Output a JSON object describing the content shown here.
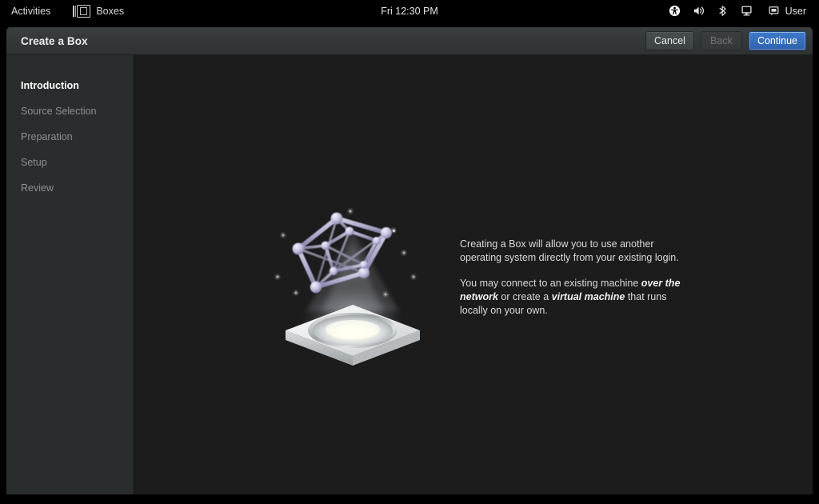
{
  "topbar": {
    "activities_label": "Activities",
    "app_name": "Boxes",
    "clock": "Fri 12:30 PM",
    "user_label": "User",
    "tray_icons": [
      "accessibility-icon",
      "volume-icon",
      "bluetooth-icon",
      "display-icon",
      "message-icon"
    ]
  },
  "window": {
    "title": "Create a Box",
    "buttons": {
      "cancel": "Cancel",
      "back": "Back",
      "continue": "Continue"
    },
    "accent_color": "#3d7bcd"
  },
  "sidebar": {
    "steps": [
      {
        "label": "Introduction",
        "active": true
      },
      {
        "label": "Source Selection",
        "active": false
      },
      {
        "label": "Preparation",
        "active": false
      },
      {
        "label": "Setup",
        "active": false
      },
      {
        "label": "Review",
        "active": false
      }
    ]
  },
  "main": {
    "illustration_name": "boxes-welcome-hologram-illustration",
    "paragraph1": "Creating a Box will allow you to use another operating system directly from your existing login.",
    "paragraph2_part1": "You may connect to an existing machine ",
    "paragraph2_emphasis1": "over the network",
    "paragraph2_part2": " or create a ",
    "paragraph2_emphasis2": "virtual machine",
    "paragraph2_part3": " that runs locally on your own."
  }
}
